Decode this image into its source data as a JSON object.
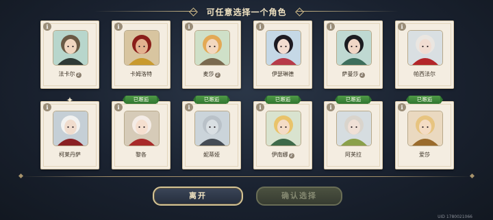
{
  "header": {
    "title": "可任意选择一个角色"
  },
  "info_icon": "i",
  "characters_row1": [
    {
      "name": "法卡尔",
      "marker": "2",
      "colors": {
        "bg": "#b8d6cc",
        "hair": "#6b5a45",
        "skin": "#f0d6c0",
        "accent": "#2f3a36"
      }
    },
    {
      "name": "卡姆洛特",
      "marker": "",
      "colors": {
        "bg": "#d8c5a0",
        "hair": "#8a1e1a",
        "skin": "#e3b18f",
        "accent": "#c99a2e"
      }
    },
    {
      "name": "麦莎",
      "marker": "2",
      "colors": {
        "bg": "#cfe0c8",
        "hair": "#e3a955",
        "skin": "#f3d8bf",
        "accent": "#7a6a50"
      }
    },
    {
      "name": "伊瑟琳德",
      "marker": "",
      "colors": {
        "bg": "#c5d8e6",
        "hair": "#1d1a22",
        "skin": "#f2dcd0",
        "accent": "#b73b4a"
      }
    },
    {
      "name": "萨曼莎",
      "marker": "2",
      "colors": {
        "bg": "#bfd9d2",
        "hair": "#1b1c20",
        "skin": "#f0d7c6",
        "accent": "#3d6e5c"
      }
    },
    {
      "name": "帕西法尔",
      "marker": "",
      "colors": {
        "bg": "#d9dfe2",
        "hair": "#eae6e1",
        "skin": "#f1ddd2",
        "accent": "#b3262a"
      }
    }
  ],
  "characters_row2": [
    {
      "name": "柯莱丹萨",
      "marker": "",
      "badge": false,
      "colors": {
        "bg": "#c5cfd6",
        "hair": "#f2f2f0",
        "skin": "#f0dccd",
        "accent": "#8a2024"
      }
    },
    {
      "name": "黎各",
      "marker": "",
      "badge": true,
      "colors": {
        "bg": "#d6cbb8",
        "hair": "#f4ece6",
        "skin": "#f5dfcf",
        "accent": "#a82a2a"
      }
    },
    {
      "name": "妮蒂娅",
      "marker": "",
      "badge": true,
      "colors": {
        "bg": "#cbd4da",
        "hair": "#b9c1c8",
        "skin": "#d9dfe3",
        "accent": "#454c55"
      }
    },
    {
      "name": "伊南娜",
      "marker": "2",
      "badge": true,
      "colors": {
        "bg": "#d9e3cf",
        "hair": "#e9c36a",
        "skin": "#f4dcc6",
        "accent": "#3e6a4a"
      }
    },
    {
      "name": "阿芙拉",
      "marker": "",
      "badge": true,
      "colors": {
        "bg": "#d6dde0",
        "hair": "#d9d4cc",
        "skin": "#f0e0d6",
        "accent": "#8aa04a"
      }
    },
    {
      "name": "爱莎",
      "marker": "",
      "badge": true,
      "colors": {
        "bg": "#ead9c0",
        "hair": "#e7c480",
        "skin": "#f4dcc4",
        "accent": "#9a6b2c"
      }
    }
  ],
  "badge_text": "已邂逅",
  "buttons": {
    "leave": "离开",
    "confirm": "确认选择"
  },
  "uid": "UID 1780021066"
}
